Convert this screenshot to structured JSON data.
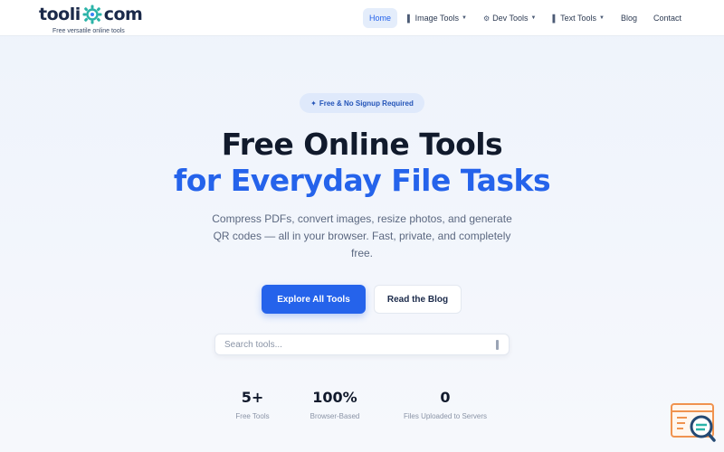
{
  "brand": {
    "name_left": "tooli",
    "name_right": "com",
    "tagline": "Free versatile online tools"
  },
  "nav": {
    "items": [
      {
        "label": "Home",
        "active": true
      },
      {
        "label": "Image Tools",
        "icon": "image-icon",
        "dropdown": true
      },
      {
        "label": "Dev Tools",
        "icon": "gear-icon",
        "dropdown": true
      },
      {
        "label": "Text Tools",
        "icon": "text-icon",
        "dropdown": true
      },
      {
        "label": "Blog"
      },
      {
        "label": "Contact"
      }
    ]
  },
  "hero": {
    "badge": "Free & No Signup Required",
    "badge_icon": "sparkle-icon",
    "title_line1": "Free Online Tools",
    "title_line2": "for Everyday File Tasks",
    "subtitle": "Compress PDFs, convert images, resize photos, and generate QR codes — all in your browser. Fast, private, and completely free.",
    "primary_button": "Explore All Tools",
    "secondary_button": "Read the Blog"
  },
  "search": {
    "placeholder": "Search tools...",
    "value": ""
  },
  "stats": [
    {
      "value": "5+",
      "label": "Free Tools"
    },
    {
      "value": "100%",
      "label": "Browser-Based"
    },
    {
      "value": "0",
      "label": "Files Uploaded to Servers"
    }
  ],
  "colors": {
    "accent": "#2563eb",
    "heading": "#111a2c",
    "muted": "#5b6880",
    "brand_gear": "#2bb3a8"
  }
}
